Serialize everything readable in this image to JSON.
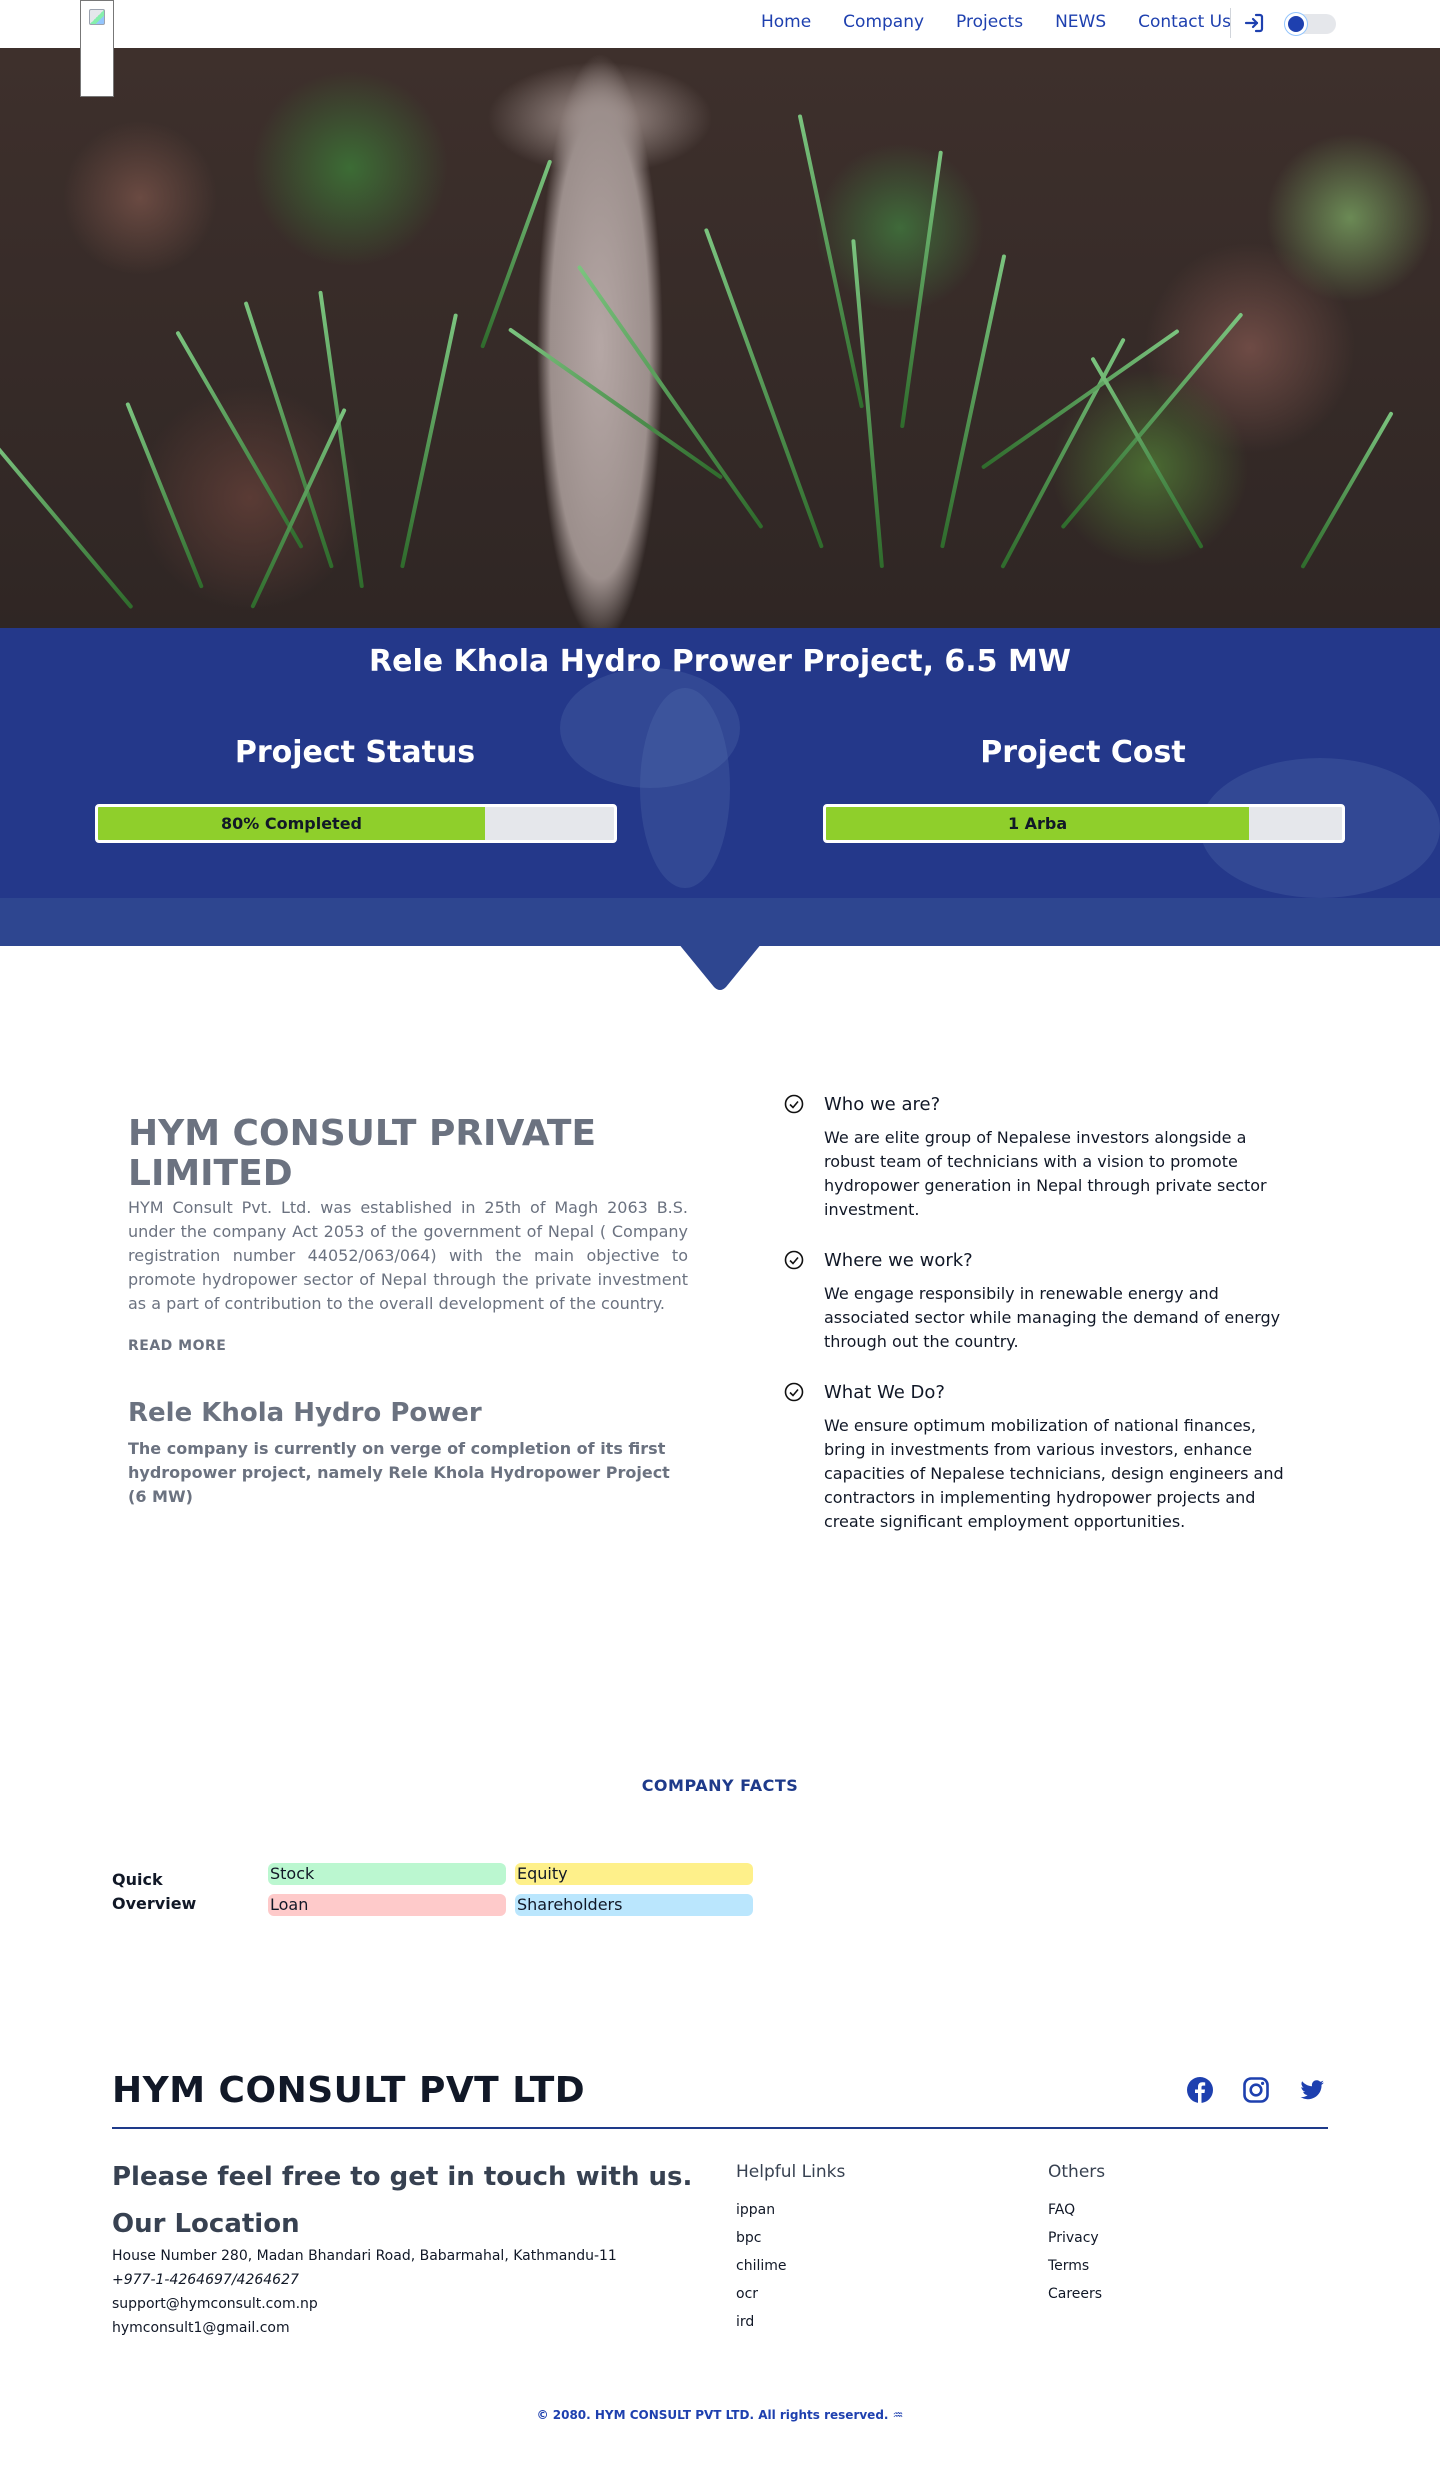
{
  "nav": {
    "links": [
      "Home",
      "Company",
      "Projects",
      "NEWS",
      "Contact Us"
    ],
    "login_icon": "login-arrow-icon",
    "theme_toggle_icon": "sun-icon"
  },
  "hero": {
    "title": "Rele Khola Hydro Prower Project, 6.5 MW",
    "status": {
      "heading": "Project Status",
      "label": "80% Completed",
      "progress": 0.75
    },
    "cost": {
      "heading": "Project Cost",
      "label": "1 Arba",
      "progress": 0.82
    }
  },
  "about": {
    "title": "HYM CONSULT PRIVATE LIMITED",
    "body": "HYM Consult Pvt. Ltd. was established in 25th of Magh 2063 B.S. under the company Act 2053 of the government of Nepal ( Company registration number 44052/063/064) with the main objective to promote hydropower sector of Nepal through the private investment as a part of contribution to the overall development of the country.",
    "read_more": "READ MORE",
    "project_title": "Rele Khola Hydro Power",
    "project_body": "The company is currently on verge of completion of its first hydropower project, namely Rele Khola Hydropower Project (6 MW)"
  },
  "features": [
    {
      "title": "Who we are?",
      "body": "We are elite group of Nepalese investors alongside a robust team of technicians with a vision to promote hydropower generation in Nepal through private sector investment."
    },
    {
      "title": "Where we work?",
      "body": "We engage responsibily in renewable energy and associated sector while managing the demand of energy through out the country."
    },
    {
      "title": "What We Do?",
      "body": "We ensure optimum mobilization of national finances, bring in investments from various investors, enhance capacities of Nepalese technicians, design engineers and contractors in implementing hydropower projects and create significant employment opportunities."
    }
  ],
  "facts": {
    "heading": "COMPANY FACTS",
    "quick_overview": "Quick Overview",
    "pills": [
      {
        "label": "Stock",
        "color": "#bbf7d0"
      },
      {
        "label": "Equity",
        "color": "#fef08a"
      },
      {
        "label": "Loan",
        "color": "#fecaca"
      },
      {
        "label": "Shareholders",
        "color": "#bae6fd"
      }
    ]
  },
  "footer": {
    "brand": "HYM CONSULT PVT LTD",
    "social_icons": [
      "facebook-icon",
      "instagram-icon",
      "twitter-icon"
    ],
    "touch": "Please feel free to get in touch with us.",
    "location_title": "Our Location",
    "address": "House Number 280, Madan Bhandari Road, Babarmahal, Kathmandu-11",
    "phone": "+977-1-4264697/4264627",
    "email1": "support@hymconsult.com.np",
    "email2": "hymconsult1@gmail.com",
    "helpful_title": "Helpful Links",
    "helpful_links": [
      "ippan",
      "bpc",
      "chilime",
      "ocr",
      "ird"
    ],
    "others_title": "Others",
    "others_links": [
      "FAQ",
      "Privacy",
      "Terms",
      "Careers"
    ],
    "copyright": "© 2080. HYM CONSULT PVT LTD. All rights reserved. ♒"
  },
  "colors": {
    "brand_blue": "#24388a",
    "link_blue": "#1e40af",
    "progress_green": "#8fcf2b"
  }
}
